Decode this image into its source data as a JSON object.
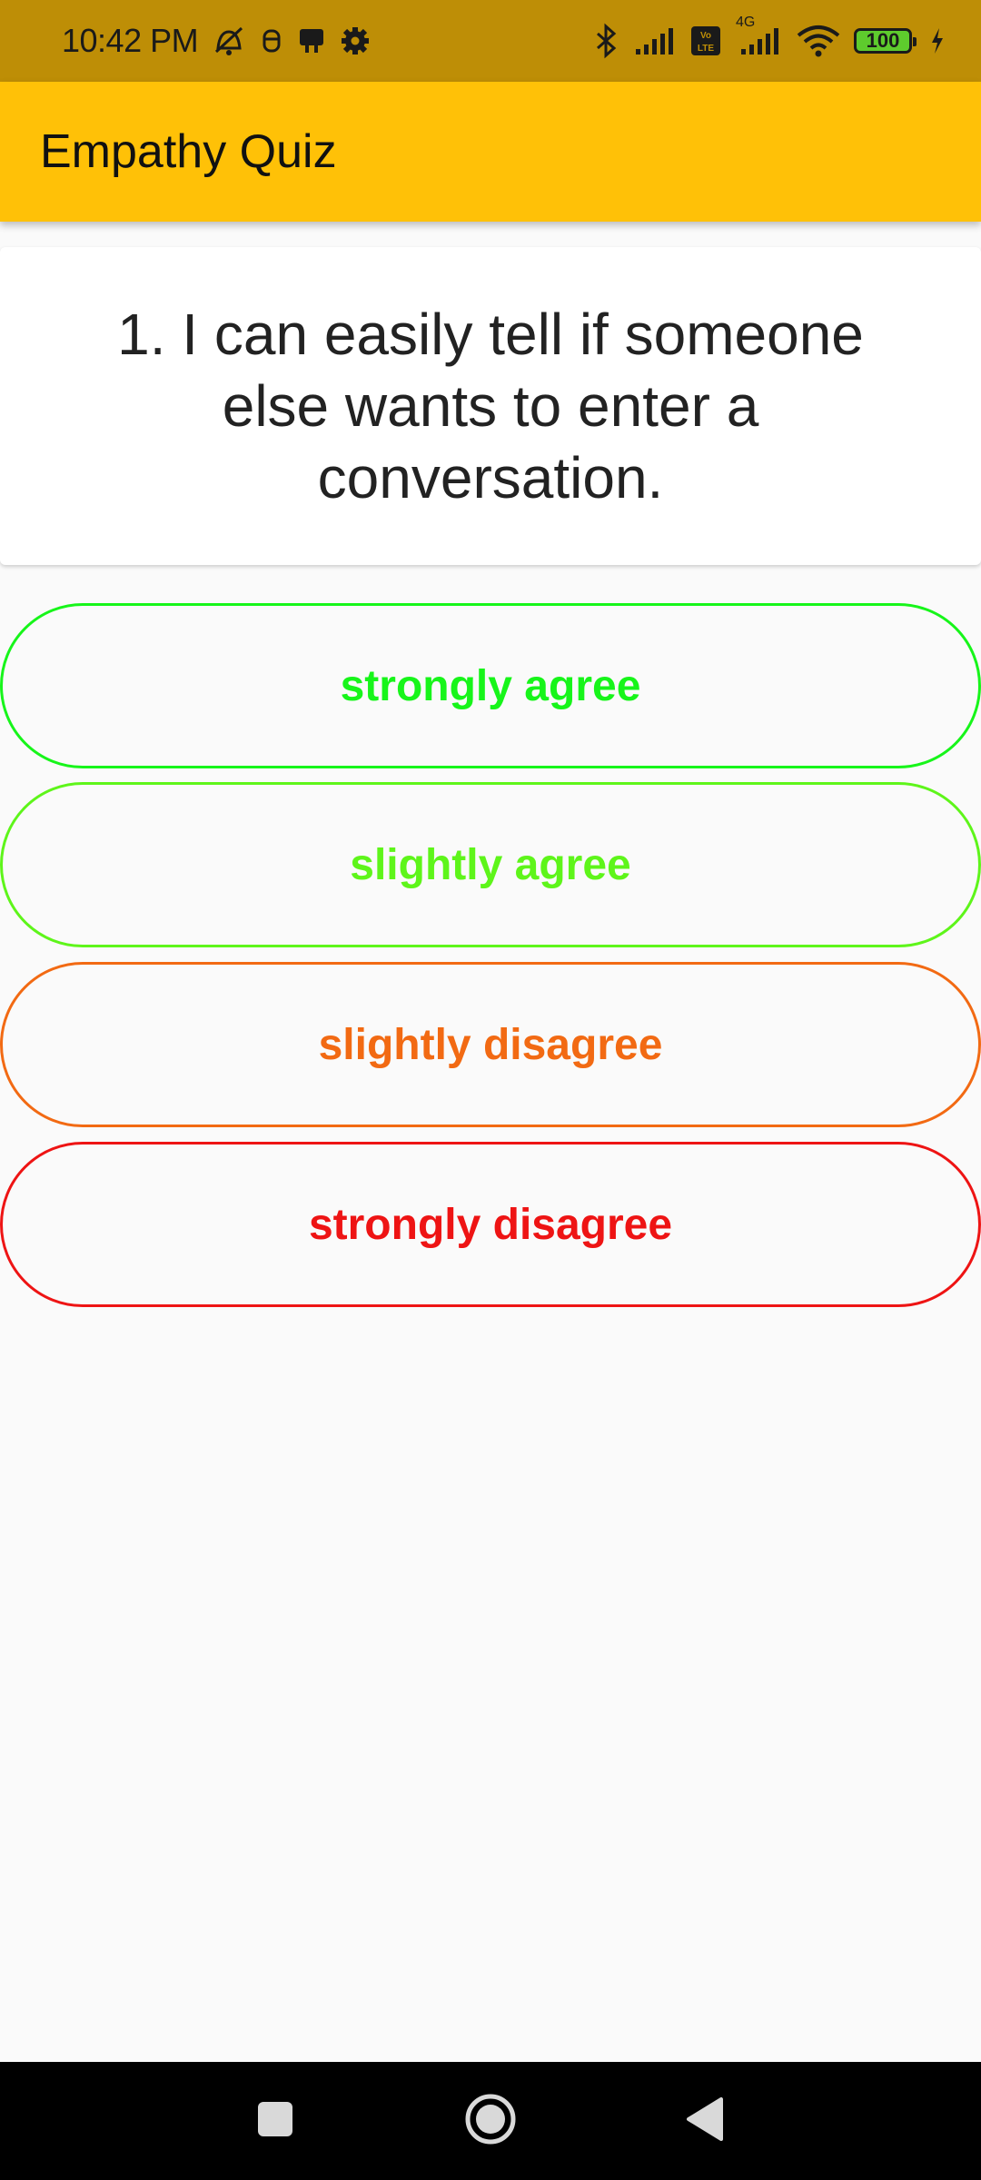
{
  "status_bar": {
    "time": "10:42 PM",
    "battery_level": "100",
    "icons": [
      "mute-icon",
      "notification-icon",
      "app-icon",
      "settings-icon",
      "bluetooth-icon",
      "signal-icon",
      "volte-icon",
      "4g-signal-icon",
      "wifi-icon",
      "battery-icon",
      "charging-icon"
    ],
    "network_label": "4G",
    "volte_label": "Vo LTE"
  },
  "app_bar": {
    "title": "Empathy Quiz"
  },
  "question": {
    "text": "1. I can easily tell if someone else wants to enter a conversation."
  },
  "answers": [
    {
      "label": "strongly agree",
      "color": "#17F51A"
    },
    {
      "label": "slightly agree",
      "color": "#5EF51A"
    },
    {
      "label": "slightly disagree",
      "color": "#F26A13"
    },
    {
      "label": "strongly disagree",
      "color": "#EE1414"
    }
  ],
  "colors": {
    "status_bar": "#BE8E06",
    "app_bar": "#FFC107",
    "background": "#FAFAFA"
  },
  "nav_bar": {
    "icons": [
      "recents-square-icon",
      "home-circle-icon",
      "back-triangle-icon"
    ]
  }
}
